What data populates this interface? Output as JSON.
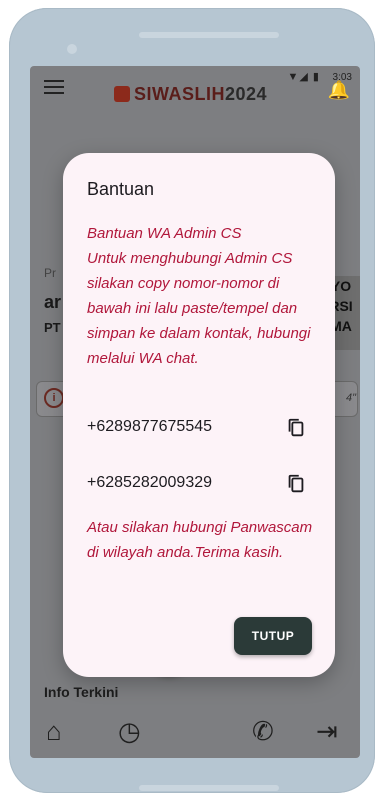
{
  "status_bar": {
    "time": "3:03",
    "icons": "▼◢ ▮"
  },
  "header": {
    "brand": "SIWASLIH",
    "brand_year": "2024"
  },
  "background": {
    "label_partial": "Pr",
    "name_partial": "ar",
    "org_partial": "PT",
    "info_partial": "4\"",
    "banner_text": "YO\nRSI\nMA"
  },
  "dialog": {
    "title": "Bantuan",
    "message": "Bantuan WA Admin CS\nUntuk menghubungi Admin CS silakan copy nomor-nomor di bawah ini lalu paste/tempel dan simpan ke dalam kontak, hubungi melalui WA chat.",
    "phones": [
      "+6289877675545",
      "+6285282009329"
    ],
    "footer": "Atau silakan hubungi Panwascam di wilayah anda.Terima kasih.",
    "close_label": "TUTUP"
  },
  "bottom": {
    "info_title": "Info Terkini",
    "fab_label": "+"
  },
  "colors": {
    "accent": "#2b3a38",
    "message": "#b1173b",
    "dialog_bg": "#fdf3f8"
  },
  "icons": [
    "menu-icon",
    "bell-icon",
    "copy-icon",
    "home-icon",
    "history-icon",
    "phone-icon",
    "logout-icon",
    "plus-icon"
  ]
}
